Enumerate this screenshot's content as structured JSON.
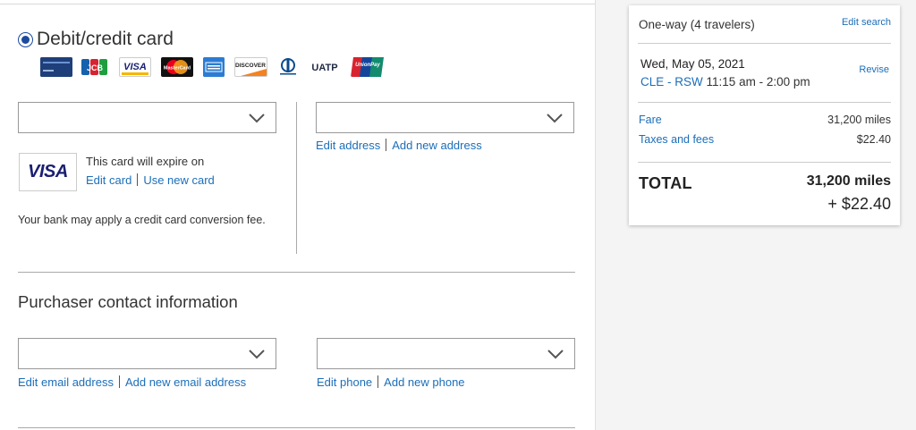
{
  "payment": {
    "title": "Debit/credit card",
    "card_logos": [
      "MileagePlus card",
      "JCB",
      "VISA",
      "MasterCard",
      "American Express",
      "DISCOVER",
      "Diners Club International",
      "UATP",
      "UnionPay"
    ],
    "card_select": {
      "value": ""
    },
    "address_select": {
      "value": ""
    },
    "edit_address": "Edit address",
    "add_new_address": "Add new address",
    "visa_label": "VISA",
    "expire_text": "This card will expire on",
    "edit_card": "Edit card",
    "use_new_card": "Use new card",
    "bank_note": "Your bank may apply a credit card conversion fee."
  },
  "purchaser": {
    "title": "Purchaser contact information",
    "email_select": {
      "value": ""
    },
    "phone_select": {
      "value": ""
    },
    "edit_email": "Edit email address",
    "add_email": "Add new email address",
    "edit_phone": "Edit phone",
    "add_phone": "Add new phone"
  },
  "summary": {
    "trip": "One-way (4 travelers)",
    "edit_search": "Edit search",
    "date": "Wed, May 05, 2021",
    "revise": "Revise",
    "route": "CLE - RSW",
    "times": "11:15 am - 2:00 pm",
    "fare_label": "Fare",
    "fare_value": "31,200 miles",
    "taxes_label": "Taxes and fees",
    "taxes_value": "$22.40",
    "total_label": "TOTAL",
    "total_miles": "31,200 miles",
    "total_cash": "+ $22.40"
  },
  "colors": {
    "link": "#1c6eb9",
    "radio": "#1b4a9e",
    "visa_blue": "#1a1f71"
  }
}
